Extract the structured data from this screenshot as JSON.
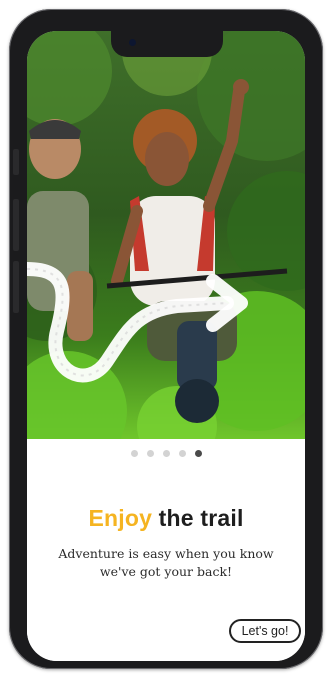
{
  "onboarding": {
    "title_highlight": "Enjoy",
    "title_rest": "the trail",
    "subtitle": "Adventure is easy when you know we've got your back!",
    "cta_label": "Let's go!",
    "page_indicator": {
      "total": 5,
      "current": 5
    }
  },
  "colors": {
    "accent": "#f5b421",
    "text": "#1e1e1e",
    "dot_active": "#4a4a4a",
    "dot_inactive": "#d3d3d3"
  },
  "icons": [
    "trail-arrow-icon",
    "camera-dot-icon"
  ]
}
